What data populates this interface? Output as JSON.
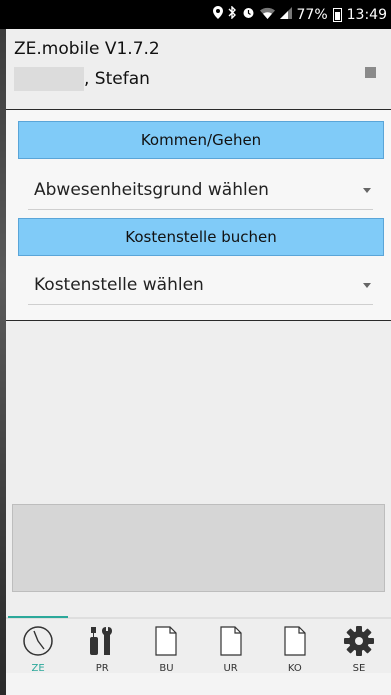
{
  "status_bar": {
    "battery": "77%",
    "time": "13:49"
  },
  "header": {
    "title": "ZE.mobile V1.7.2",
    "user_name": ", Stefan"
  },
  "actions": {
    "kommen_gehen_label": "Kommen/Gehen",
    "abwesenheit_select": "Abwesenheitsgrund wählen",
    "kostenstelle_button_label": "Kostenstelle buchen",
    "kostenstelle_select": "Kostenstelle wählen"
  },
  "bottom_nav": {
    "items": [
      {
        "label": "ZE",
        "icon": "clock-icon",
        "active": true
      },
      {
        "label": "PR",
        "icon": "tools-icon",
        "active": false
      },
      {
        "label": "BU",
        "icon": "document-icon",
        "active": false
      },
      {
        "label": "UR",
        "icon": "document-icon",
        "active": false
      },
      {
        "label": "KO",
        "icon": "document-icon",
        "active": false
      },
      {
        "label": "SE",
        "icon": "gear-icon",
        "active": false
      }
    ]
  },
  "colors": {
    "button_blue": "#80cbf8",
    "active_tab": "#2ba89a"
  }
}
